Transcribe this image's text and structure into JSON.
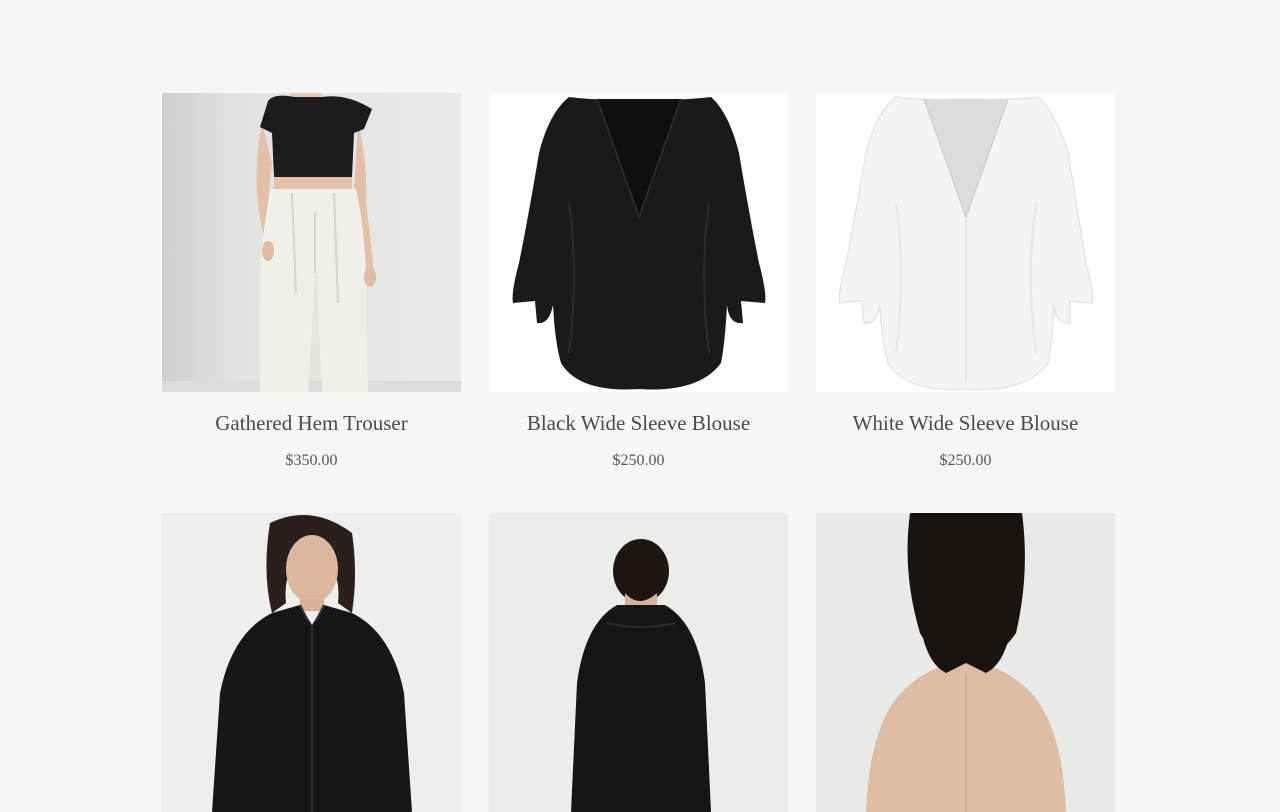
{
  "products": [
    {
      "title": "Gathered Hem Trouser",
      "price": "$350.00",
      "image_icon": "model-crop-top-white-trousers"
    },
    {
      "title": "Black Wide Sleeve Blouse",
      "price": "$250.00",
      "image_icon": "black-v-neck-blouse"
    },
    {
      "title": "White Wide Sleeve Blouse",
      "price": "$250.00",
      "image_icon": "white-v-neck-blouse"
    },
    {
      "title": "",
      "price": "",
      "image_icon": "model-black-shirt-front"
    },
    {
      "title": "",
      "price": "",
      "image_icon": "model-black-shirt-back"
    },
    {
      "title": "",
      "price": "",
      "image_icon": "model-bare-back"
    }
  ]
}
